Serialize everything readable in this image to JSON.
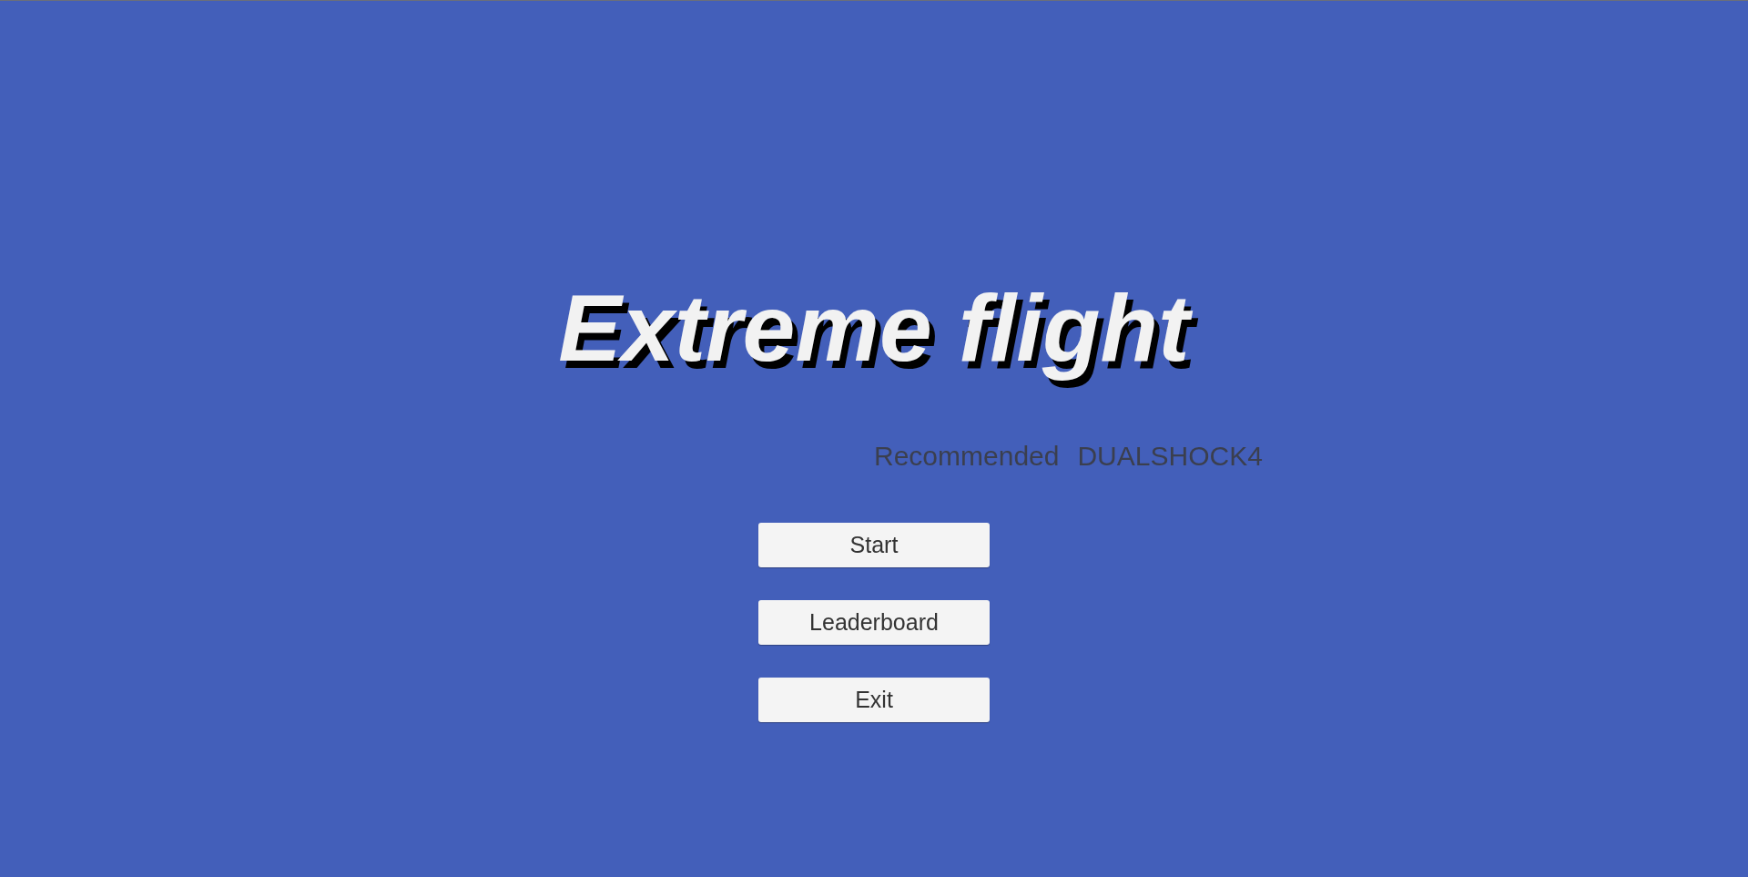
{
  "title": "Extreme flight",
  "recommendation": {
    "label": "Recommended",
    "device": "DUALSHOCK4"
  },
  "buttons": [
    {
      "label": "Start"
    },
    {
      "label": "Leaderboard"
    },
    {
      "label": "Exit"
    }
  ]
}
